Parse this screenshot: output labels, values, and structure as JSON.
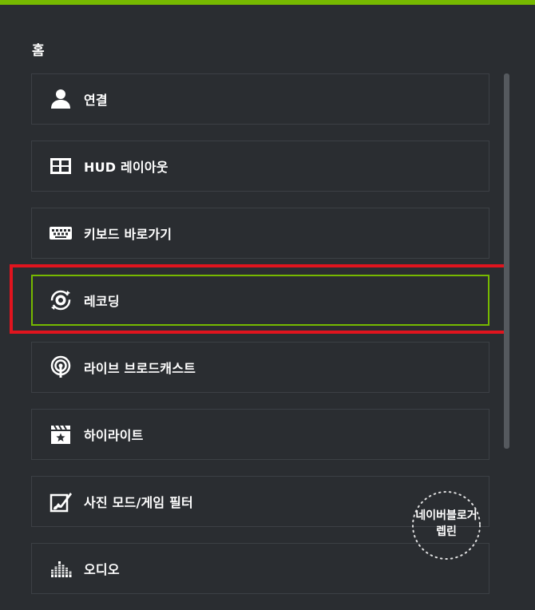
{
  "page": {
    "title": "홈"
  },
  "menu": {
    "items": [
      {
        "label": "연결",
        "icon": "user-icon"
      },
      {
        "label": "HUD 레이아웃",
        "icon": "layout-grid-icon"
      },
      {
        "label": "키보드 바로가기",
        "icon": "keyboard-icon"
      },
      {
        "label": "레코딩",
        "icon": "record-icon",
        "selected": true
      },
      {
        "label": "라이브 브로드캐스트",
        "icon": "broadcast-icon"
      },
      {
        "label": "하이라이트",
        "icon": "clapperboard-star-icon"
      },
      {
        "label": "사진 모드/게임 필터",
        "icon": "photo-filter-icon"
      },
      {
        "label": "오디오",
        "icon": "equalizer-icon"
      }
    ]
  },
  "watermark": {
    "line1": "네이버블로거",
    "line2": "렙린"
  },
  "colors": {
    "accent": "#76b900",
    "highlight": "#e0141e",
    "background": "#2a2d31",
    "border": "#3c4045"
  }
}
